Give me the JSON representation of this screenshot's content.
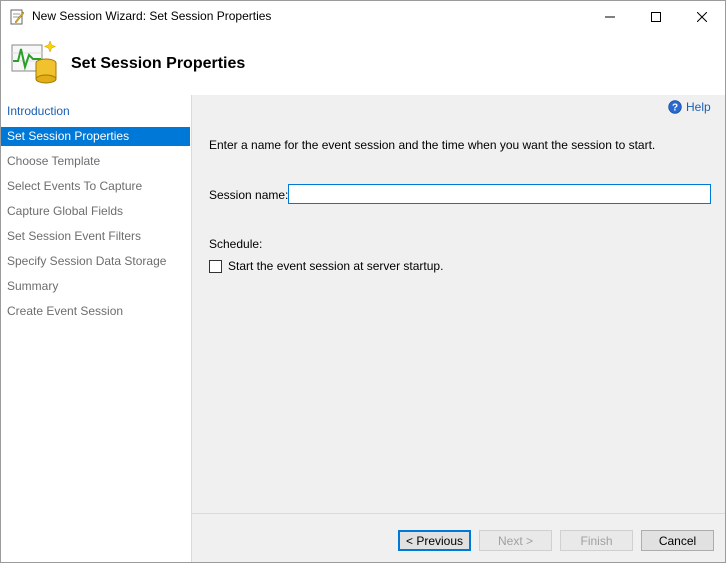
{
  "window": {
    "title": "New Session Wizard: Set Session Properties",
    "controls": {
      "minimize": "minimize-icon",
      "maximize": "maximize-icon",
      "close": "close-icon"
    }
  },
  "header": {
    "title": "Set Session Properties",
    "icon": "event-session-icon"
  },
  "sidebar": {
    "items": [
      {
        "label": "Introduction",
        "state": "link"
      },
      {
        "label": "Set Session Properties",
        "state": "active"
      },
      {
        "label": "Choose Template",
        "state": "inactive"
      },
      {
        "label": "Select Events To Capture",
        "state": "inactive"
      },
      {
        "label": "Capture Global Fields",
        "state": "inactive"
      },
      {
        "label": "Set Session Event Filters",
        "state": "inactive"
      },
      {
        "label": "Specify Session Data Storage",
        "state": "inactive"
      },
      {
        "label": "Summary",
        "state": "inactive"
      },
      {
        "label": "Create Event Session",
        "state": "inactive"
      }
    ]
  },
  "main": {
    "help_label": "Help",
    "instruction": "Enter a name for the event session and the time when you want the session to start.",
    "session_name_label": "Session name:",
    "session_name_value": "",
    "schedule_label": "Schedule:",
    "startup_checkbox_label": "Start the event session at server startup.",
    "startup_checked": false
  },
  "buttons": {
    "previous": "< Previous",
    "next": "Next >",
    "finish": "Finish",
    "cancel": "Cancel"
  },
  "colors": {
    "accent": "#0078d7",
    "link": "#1a5fb4",
    "disabled_text": "#a0a0a0"
  }
}
